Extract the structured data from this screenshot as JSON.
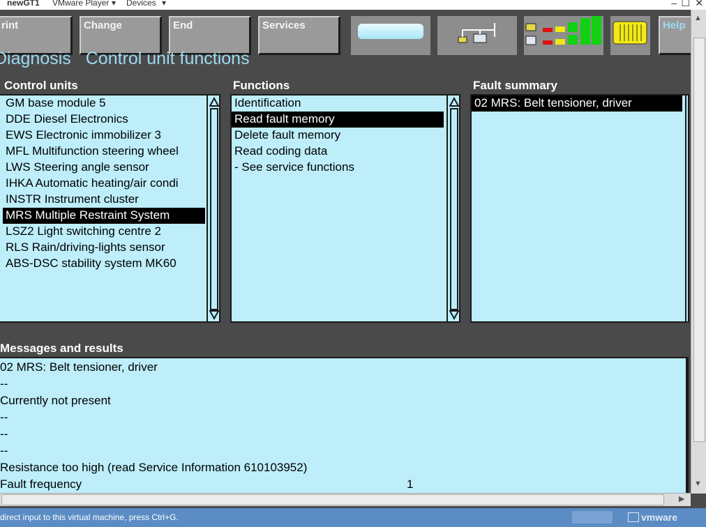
{
  "vm": {
    "title": "newGT1",
    "menu": [
      "VMware Player",
      "Devices"
    ],
    "window_controls": [
      "–",
      "☐",
      "✕"
    ],
    "status_text": "direct input to this virtual machine, press Ctrl+G.",
    "brand": "vmware"
  },
  "toolbar": {
    "print_label": "rint",
    "change_label": "Change",
    "end_label": "End",
    "services_label": "Services",
    "help_label": "Help"
  },
  "heading": {
    "part1": "Diagnosis",
    "part2": "Control unit functions"
  },
  "control_units": {
    "title": "Control units",
    "items": [
      "GM base module 5",
      "DDE Diesel Electronics",
      "EWS Electronic immobilizer 3",
      "MFL Multifunction steering wheel",
      "LWS Steering angle sensor",
      "IHKA Automatic heating/air condi",
      "INSTR Instrument cluster",
      "MRS Multiple Restraint System",
      "LSZ2 Light switching centre 2",
      "RLS Rain/driving-lights sensor",
      "ABS-DSC stability system MK60"
    ],
    "selected_index": 7
  },
  "functions": {
    "title": "Functions",
    "items": [
      "Identification",
      "Read fault memory",
      "Delete fault memory",
      "Read coding data",
      "- See service functions"
    ],
    "selected_index": 1
  },
  "fault_summary": {
    "title": "Fault summary",
    "items": [
      "02 MRS: Belt tensioner, driver"
    ],
    "selected_index": 0
  },
  "messages": {
    "title": "Messages and results",
    "lines": [
      {
        "text": "02 MRS: Belt tensioner, driver",
        "value": ""
      },
      {
        "text": "--",
        "value": ""
      },
      {
        "text": "Currently not present",
        "value": ""
      },
      {
        "text": "--",
        "value": ""
      },
      {
        "text": "--",
        "value": ""
      },
      {
        "text": "--",
        "value": ""
      },
      {
        "text": "Resistance too high (read Service Information 610103952)",
        "value": ""
      },
      {
        "text": "Fault frequency",
        "value": "1"
      }
    ]
  },
  "colors": {
    "list_bg": "#bdeefa",
    "heading": "#9ddaf2",
    "background": "#4a4a4a",
    "status_bar": "#5b8cc4"
  }
}
